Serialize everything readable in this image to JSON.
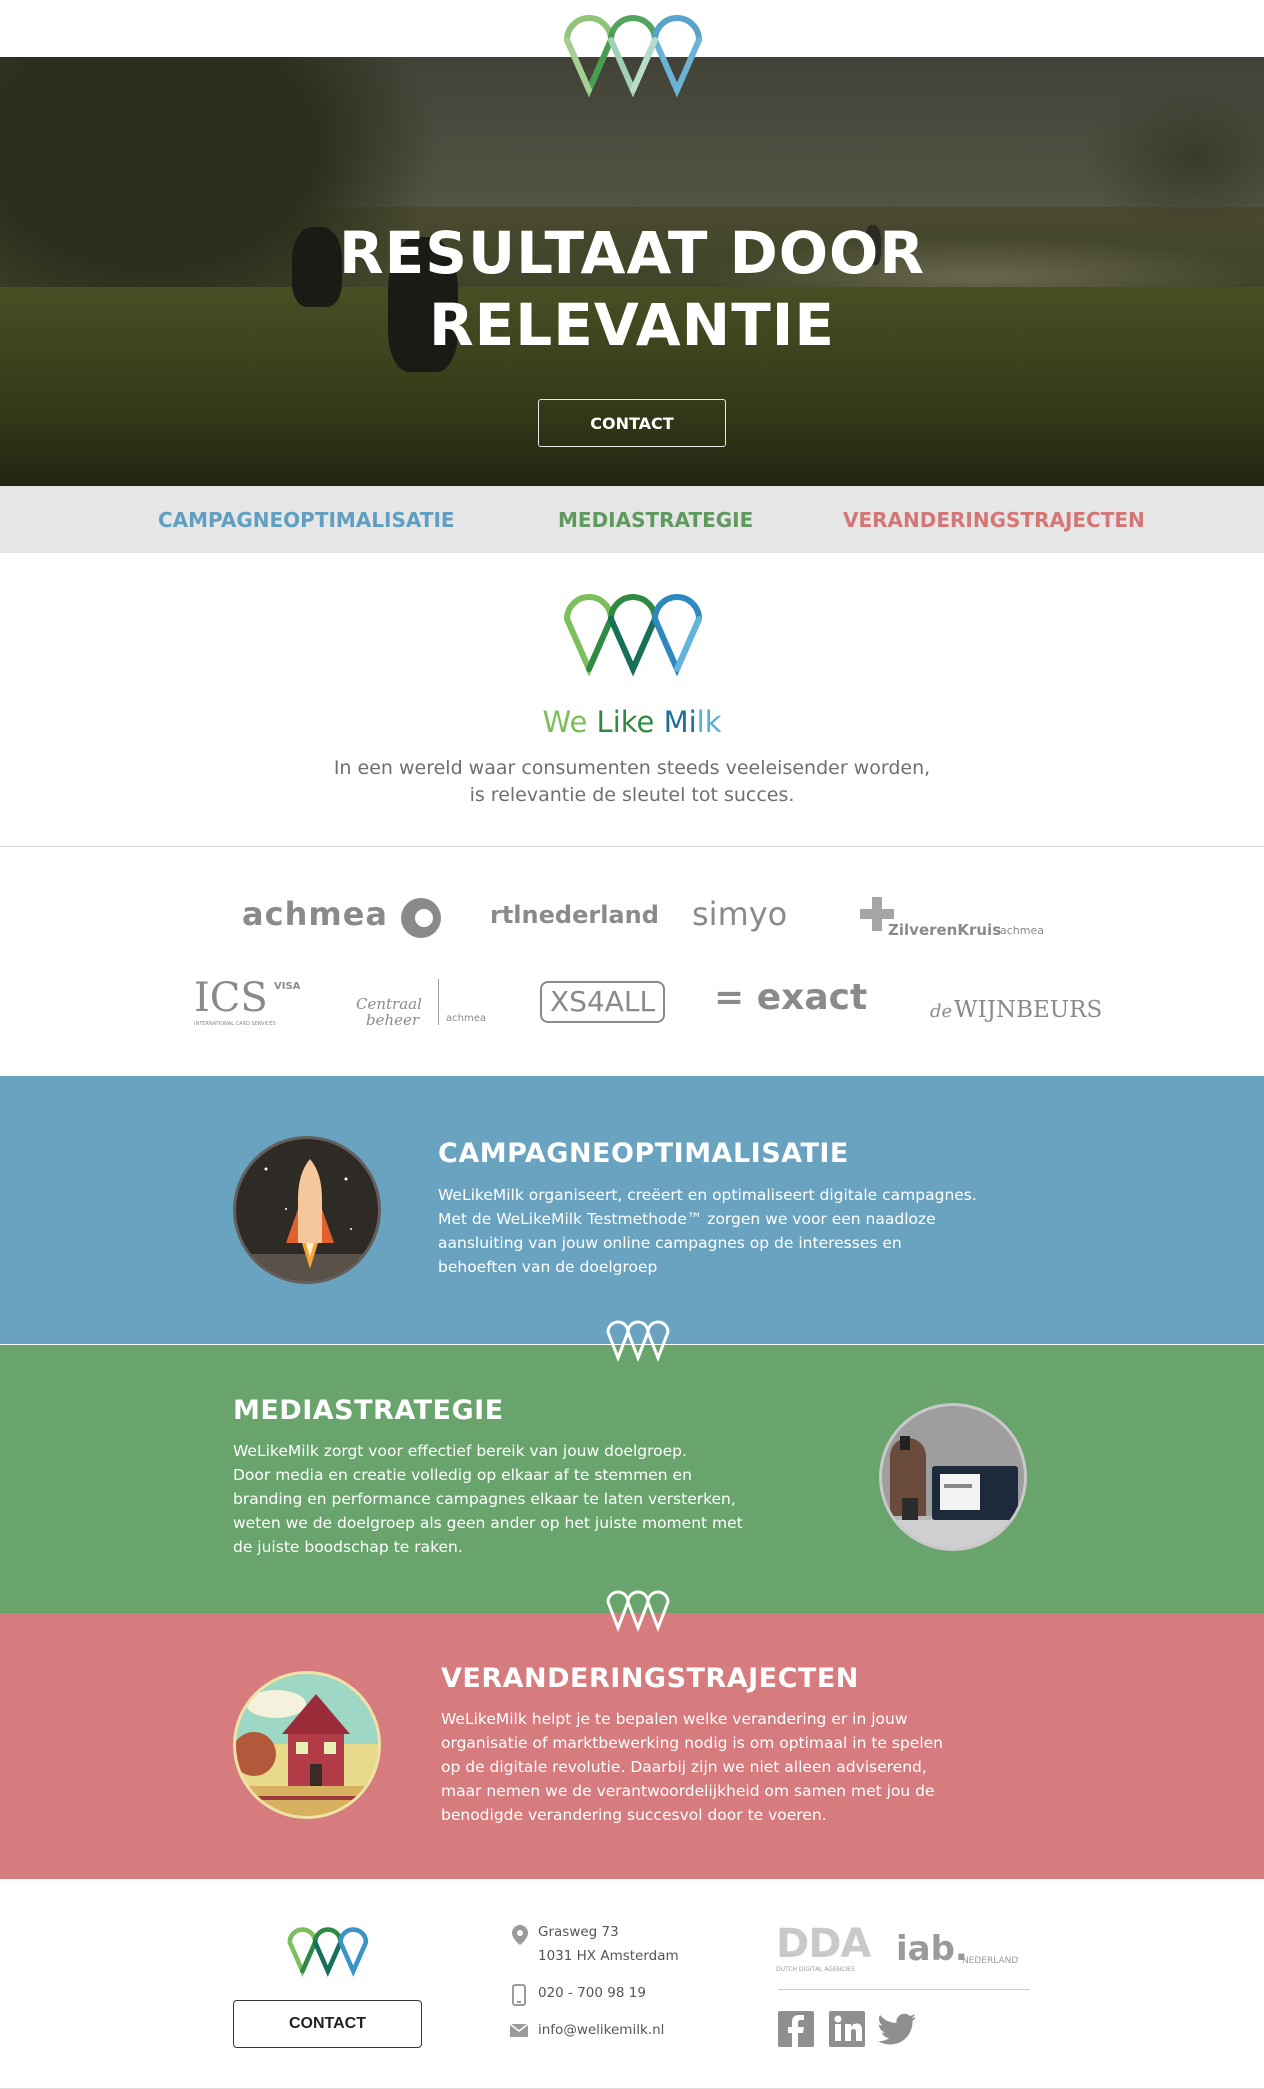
{
  "hero": {
    "title_line1": "RESULTAAT DOOR",
    "title_line2": "RELEVANTIE",
    "cta_label": "CONTACT"
  },
  "nav": {
    "items": [
      {
        "label": "CAMPAGNEOPTIMALISATIE",
        "color": "#5fa0c2"
      },
      {
        "label": "MEDIASTRATEGIE",
        "color": "#5e9a5e"
      },
      {
        "label": "VERANDERINGSTRAJECTEN",
        "color": "#d57676"
      }
    ]
  },
  "intro": {
    "brand_we": "We",
    "brand_like": "Like",
    "brand_milk_mi": "Mi",
    "brand_milk_lk": "lk",
    "tagline_line1": "In een wereld waar consumenten steeds veeleisender worden,",
    "tagline_line2": "is relevantie de sleutel tot succes."
  },
  "clients": {
    "row1": [
      "achmea",
      "rtlnederland",
      "simyo",
      "ZilverenKruis",
      "achmea"
    ],
    "row2": [
      "ICS",
      "VISA",
      "INTERNATIONAL CARD SERVICES",
      "Centraal",
      "beheer",
      "achmea",
      "XS4ALL",
      "= exact",
      "de",
      "WIJNBEURS"
    ]
  },
  "sections": [
    {
      "title": "CAMPAGNEOPTIMALISATIE",
      "color": "#6aa3c0",
      "lines": [
        "WeLikeMilk organiseert, creëert en optimaliseert digitale campagnes.",
        "Met de WeLikeMilk Testmethode™ zorgen we voor een naadloze",
        "aansluiting van jouw online campagnes op de interesses en",
        "behoeften van de doelgroep"
      ],
      "icon": "rocket-icon"
    },
    {
      "title": "MEDIASTRATEGIE",
      "color": "#68a46c",
      "lines": [
        "WeLikeMilk zorgt voor effectief bereik van jouw doelgroep.",
        "Door media en creatie volledig op elkaar af te stemmen en",
        "branding en performance campagnes elkaar te laten versterken,",
        "weten we de doelgroep als geen ander op het juiste moment met",
        "de juiste boodschap te raken."
      ],
      "icon": "laptop-icon"
    },
    {
      "title": "VERANDERINGSTRAJECTEN",
      "color": "#d67b7e",
      "lines": [
        "WeLikeMilk helpt je te bepalen welke verandering er in jouw",
        "organisatie of marktbewerking nodig is om optimaal in te spelen",
        "op de digitale revolutie. Daarbij zijn we niet alleen adviserend,",
        "maar nemen we de verantwoordelijkheid om samen met jou de",
        "benodigde verandering succesvol door te voeren."
      ],
      "icon": "house-icon"
    }
  ],
  "footer": {
    "cta_label": "CONTACT",
    "address_line1": "Grasweg 73",
    "address_line2": "1031 HX Amsterdam",
    "phone": "020 - 700 98 19",
    "email": "info@welikemilk.nl",
    "dda_label": "DDA",
    "dda_sub": "DUTCH DIGITAL AGENCIES",
    "iab_label": "iab.",
    "iab_sub": "NEDERLAND",
    "social": [
      "facebook-icon",
      "linkedin-icon",
      "twitter-icon"
    ]
  }
}
